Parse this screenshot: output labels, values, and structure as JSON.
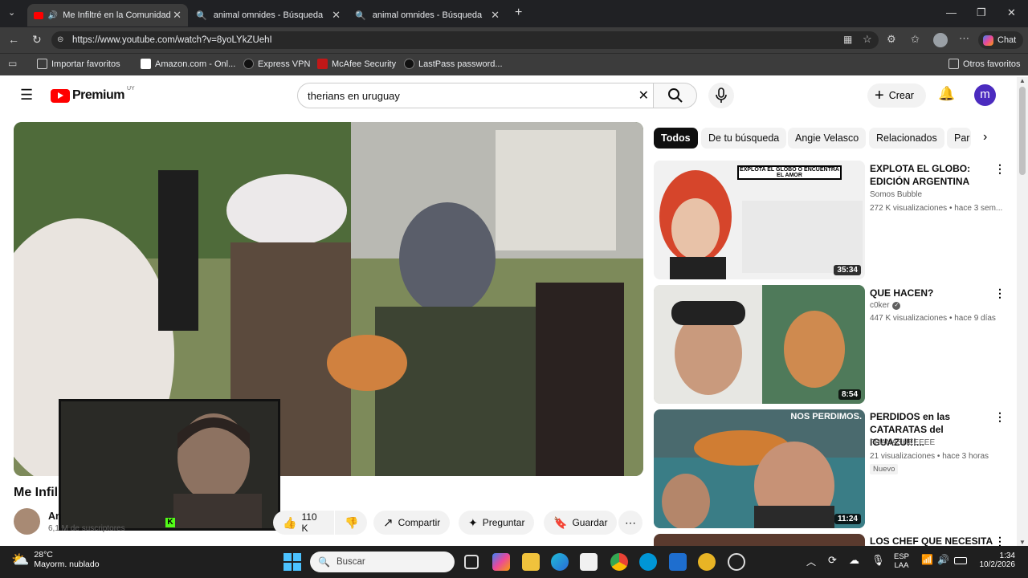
{
  "browser": {
    "tabs": [
      {
        "title": "Me Infiltré en la Comunidad T"
      },
      {
        "title": "animal omnides - Búsqueda"
      },
      {
        "title": "animal omnides - Búsqueda"
      }
    ],
    "url": "https://www.youtube.com/watch?v=8yoLYkZUehI",
    "chat_label": "Chat",
    "bookmarks": [
      "Importar favoritos",
      "Amazon.com - Onl...",
      "Express VPN",
      "McAfee Security",
      "LastPass password...",
      "Otros favoritos"
    ]
  },
  "youtube": {
    "logo_text": "Premium",
    "region": "UY",
    "search_value": "therians en uruguay",
    "create_label": "Crear",
    "avatar_letter": "m",
    "chips": [
      "Todos",
      "De tu búsqueda",
      "Angie Velasco",
      "Relacionados",
      "Par"
    ],
    "video": {
      "title_visible": "Me Infil",
      "channel_visible": "An",
      "subs_visible": "6,1 M de suscriptores",
      "likes": "110 K",
      "share_label": "Compartir",
      "ask_label": "Preguntar",
      "save_label": "Guardar"
    },
    "recommendations": [
      {
        "title": "EXPLOTA EL GLOBO: EDICIÓN ARGENTINA",
        "channel": "Somos Bubble",
        "meta": "272 K visualizaciones • hace 3 sem...",
        "duration": "35:34",
        "thumb_text": "EXPLOTA EL GLOBO O ENCUENTRA EL AMOR"
      },
      {
        "title": "QUE HACEN?",
        "channel": "c0ker",
        "meta": "447 K visualizaciones • hace 9 días",
        "duration": "8:54"
      },
      {
        "title": "PERDIDOS en las CATARATAS del IGUAZU!!!...",
        "channel": "FRANASHEEEEE",
        "meta": "21 visualizaciones • hace 3 horas",
        "badge": "Nuevo",
        "duration": "11:24",
        "thumb_text": "NOS PERDIMOS."
      },
      {
        "title": "LOS CHEF QUE NECESITA"
      }
    ]
  },
  "taskbar": {
    "weather_temp": "28°C",
    "weather_desc": "Mayorm. nublado",
    "search_placeholder": "Buscar",
    "lang1": "ESP",
    "lang2": "LAA",
    "time": "1:34",
    "date": "10/2/2026"
  },
  "colors": {
    "youtube_red": "#ff0000",
    "avatar_purple": "#4b2bbf",
    "chrome_dark": "#202124"
  }
}
